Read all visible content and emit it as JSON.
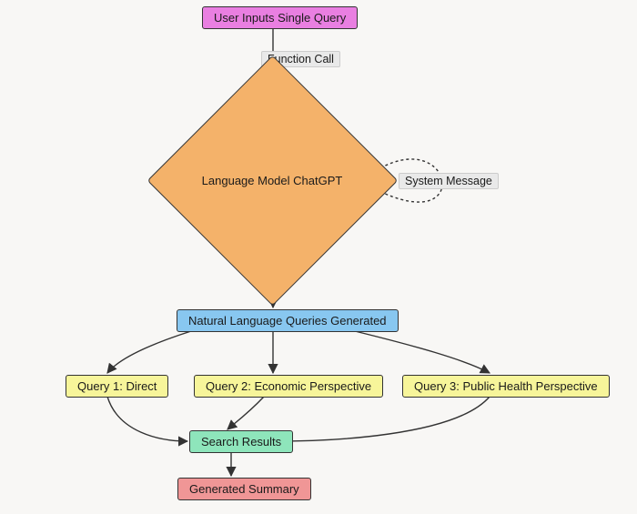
{
  "nodes": {
    "user_input": "User Inputs Single Query",
    "llm": "Language Model ChatGPT",
    "generated": "Natural Language Queries Generated",
    "query1": "Query 1: Direct",
    "query2": "Query 2: Economic Perspective",
    "query3": "Query 3: Public Health Perspective",
    "search_results": "Search Results",
    "summary": "Generated Summary"
  },
  "edges": {
    "function_call": "Function Call",
    "system_message": "System Message"
  },
  "colors": {
    "user_input": "#e97fe1",
    "llm_diamond": "#f4b26a",
    "generated": "#88c7f0",
    "queries": "#f7f59a",
    "search_results": "#8ee5bb",
    "summary": "#f09696",
    "background": "#f8f7f5"
  }
}
